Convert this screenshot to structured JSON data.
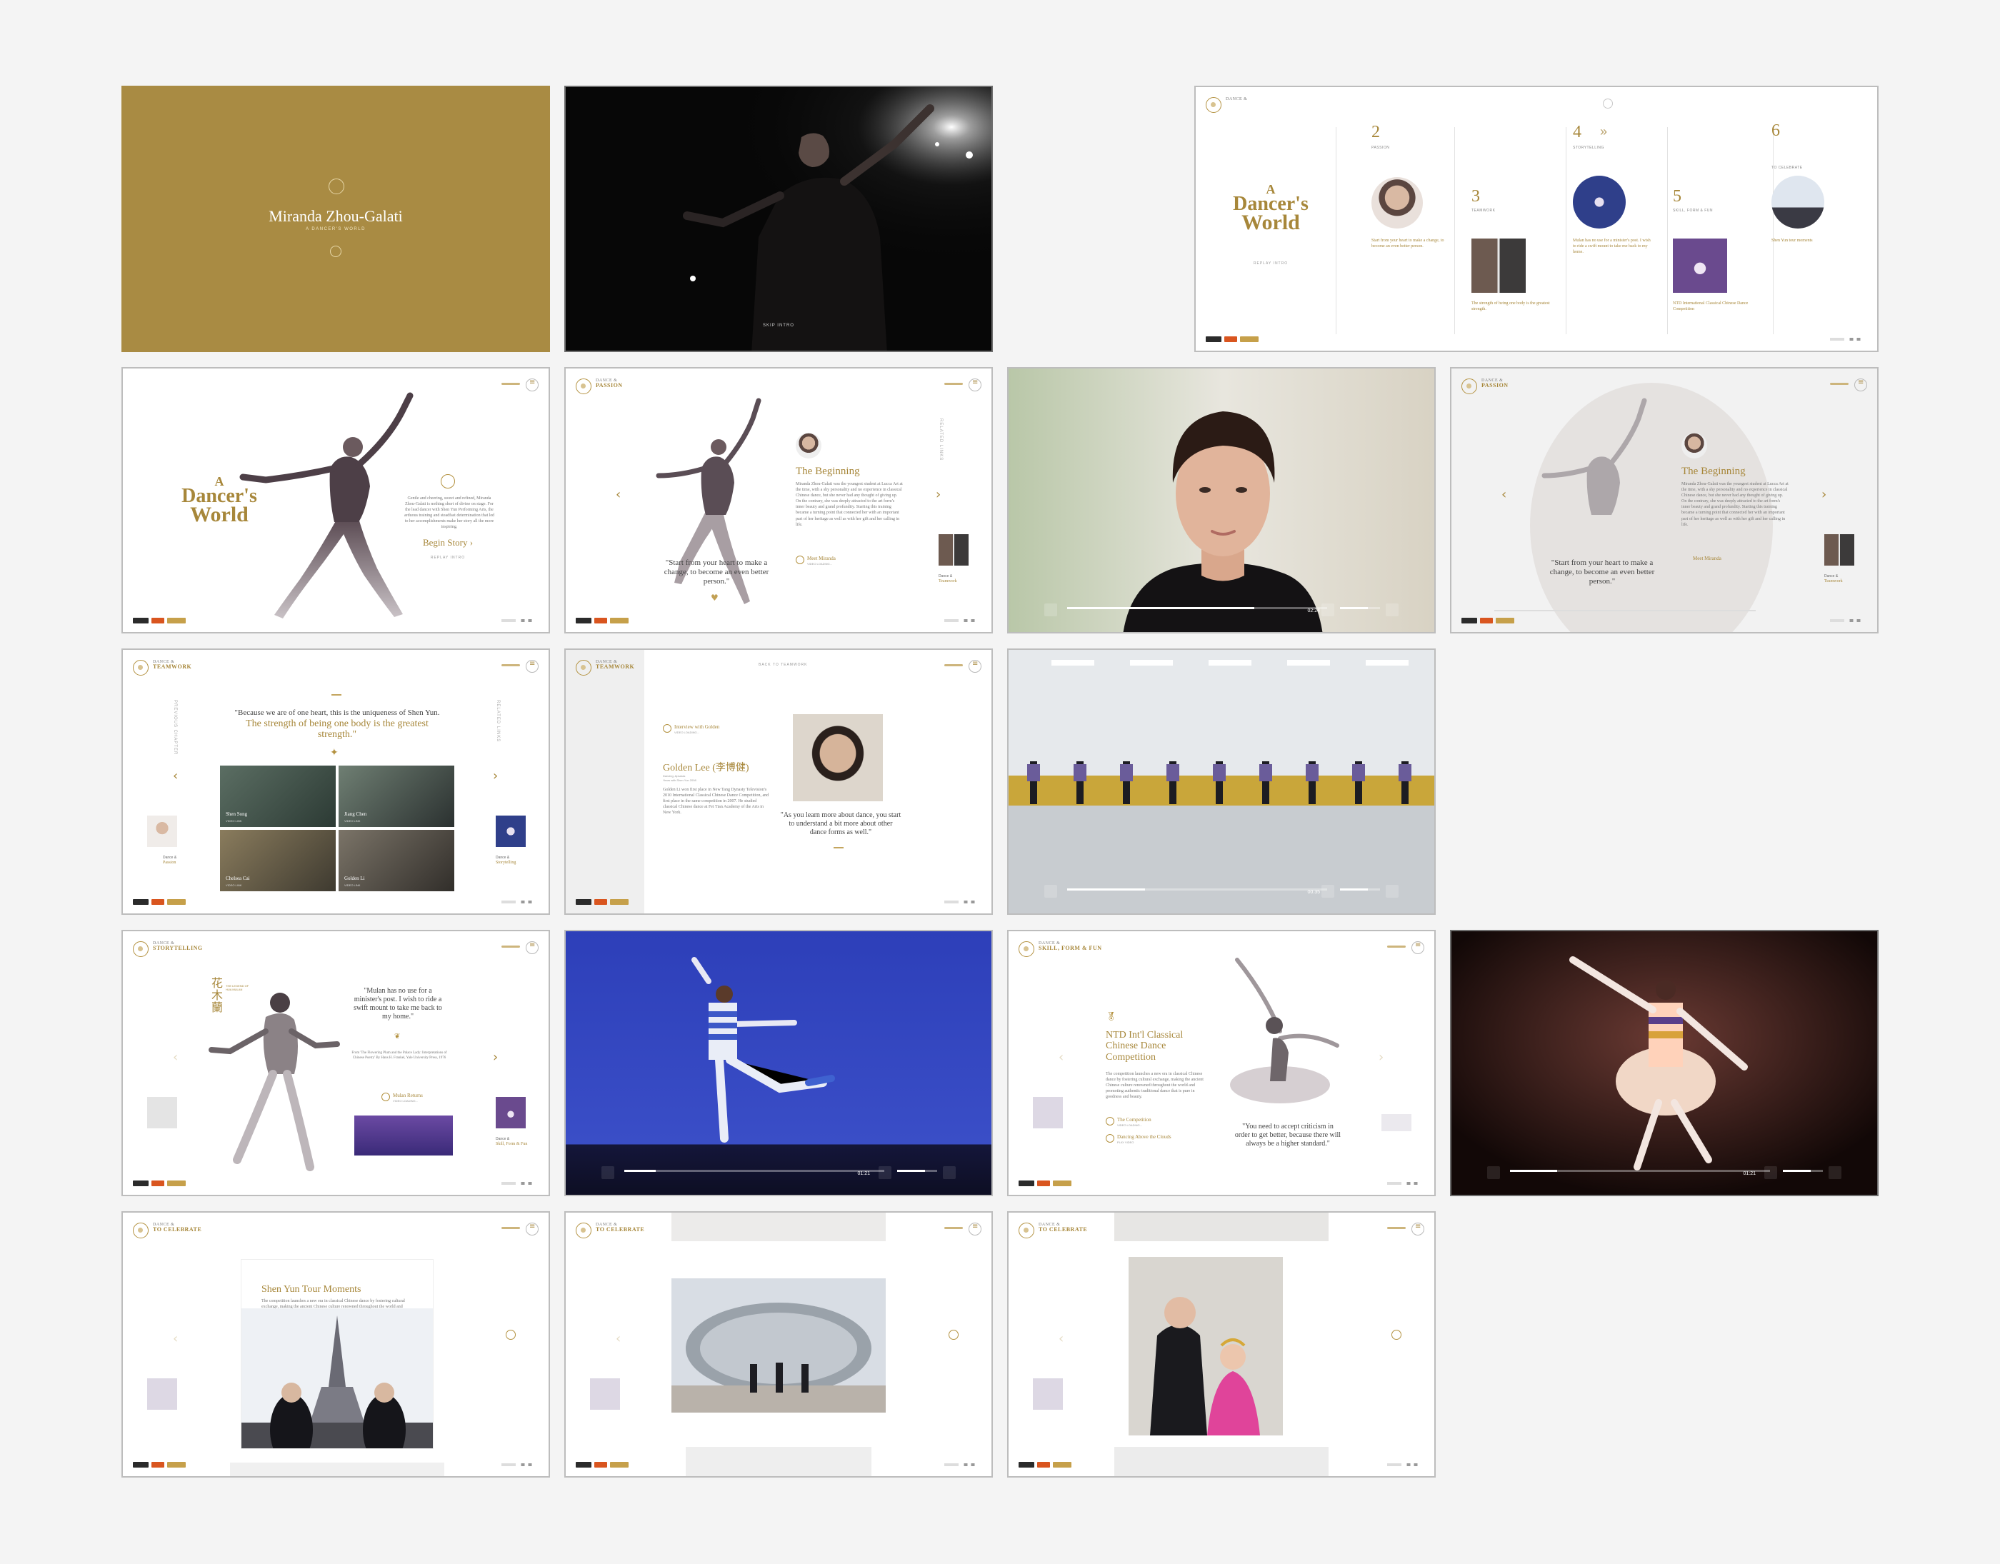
{
  "cover": {
    "name": "Miranda Zhou-Galati",
    "subtitle": "A DANCER'S WORLD"
  },
  "intro_video": {
    "skip": "SKIP INTRO"
  },
  "timeline": {
    "chapter_small": "DANCE &",
    "logo_line1": "A",
    "logo_line2": "Dancer's",
    "logo_line3": "World",
    "replay": "REPLAY INTRO",
    "items": [
      {
        "num": "2",
        "label": "PASSION",
        "caption": "Start from your heart to make a change, to become an even better person."
      },
      {
        "num": "3",
        "label": "TEAMWORK",
        "caption": "The strength of being one body is the greatest strength."
      },
      {
        "num": "4",
        "label": "STORYTELLING",
        "caption": "Mulan has no use for a minister's post. I wish to ride a swift mount to take me back to my home."
      },
      {
        "num": "5",
        "label": "SKILL, FORM & FUN",
        "caption": "NTD International Classical Chinese Dance Competition"
      },
      {
        "num": "6",
        "label": "TO CELEBRATE",
        "caption": "Shen Yun tour moments"
      }
    ]
  },
  "landing": {
    "logo_line1": "A",
    "logo_line2": "Dancer's",
    "logo_line3": "World",
    "body": "Gentle and cheering, sweet and refined, Miranda Zhou-Galati is nothing short of divine on stage. For the lead dancer with Shen Yun Performing Arts, the arduous training and steadfast determination that led to her accomplishments make her story all the more inspiring.",
    "cta": "Begin Story ›",
    "replay": "REPLAY INTRO"
  },
  "passion": {
    "chap_small": "DANCE &",
    "chap_big": "PASSION",
    "title": "The Beginning",
    "body": "Miranda Zhou-Galati was the youngest student at Lucca Art at the time, with a shy personality and no experience in classical Chinese dance, but she never had any thought of giving up. On the contrary, she was deeply attracted to the art form's inner beauty and grand profundity. Starting this training became a turning point that connected her with an important part of her heritage as well as with her gift and her calling in life.",
    "quote": "\"Start from your heart to make a change, to become an even better person.\"",
    "meet": "Meet Miranda",
    "meet_sub": "VIDEO LOADING...",
    "next_label": "Dance &",
    "next_name": "Teamwork",
    "vtext": "RELATED LINKS"
  },
  "interview_video": {
    "time": "02:24"
  },
  "teamwork": {
    "chap_small": "DANCE &",
    "chap_big": "TEAMWORK",
    "quote_a": "\"Because we are of one heart, this is the uniqueness of Shen Yun.",
    "quote_b": "The strength of being one body is the greatest strength.\"",
    "people": [
      {
        "name": "Shen Song",
        "role": "VIDEO LINK"
      },
      {
        "name": "Jiang Chen",
        "role": "VIDEO LINK"
      },
      {
        "name": "Chelsea Cai",
        "role": "VIDEO LINK"
      },
      {
        "name": "Golden Li",
        "role": "VIDEO LINK"
      }
    ],
    "prev_label": "Dance &",
    "prev_name": "Passion",
    "next_label": "Dance &",
    "next_name": "Storytelling",
    "vtext_l": "PREVIOUS CHAPTER",
    "vtext_r": "RELATED LINKS"
  },
  "golden": {
    "back": "BACK TO TEAMWORK",
    "interview": "Interview with Golden",
    "interview_sub": "VIDEO LOADING...",
    "name": "Golden Lee (李博健)",
    "meta1": "Dancing, Apsaras",
    "meta2": "Years with Shen Yun 2008",
    "body": "Golden Li won first place in New Tang Dynasty Television's 2010 International Classical Chinese Dance Competition, and first place in the same competition in 2007. He studied classical Chinese dance at Fei Tian Academy of the Arts in New York.",
    "quote": "\"As you learn more about dance, you start to understand a bit more about other dance forms as well.\""
  },
  "barre_video": {
    "time": "00:35"
  },
  "storytelling": {
    "chap_small": "DANCE &",
    "chap_big": "STORYTELLING",
    "chars": [
      "花",
      "木",
      "蘭"
    ],
    "mini": "THE LEGEND OF HUA MULAN",
    "quote": "\"Mulan has no use for a minister's post. I wish to ride a swift mount to take me back to my home.\"",
    "source": "From 'The Flowering Plum and the Palace Lady: Interpretations of Chinese Poetry' By Hans H. Frankel, Yale University Press, 1976",
    "mulan": "Mulan Returns",
    "mulan_sub": "VIDEO LOADING...",
    "next_label": "Dance &",
    "next_name": "Skill, Form & Fun"
  },
  "mulan_video": {
    "time": "01:21"
  },
  "skill": {
    "chap_small": "DANCE &",
    "chap_big": "SKILL, FORM & FUN",
    "title": "NTD Int'l Classical Chinese Dance Competition",
    "body": "The competition launches a new era in classical Chinese dance by fostering cultural exchange, making the ancient Chinese culture renowned throughout the world and promoting authentic traditional dance that is pure in goodness and beauty.",
    "link1": "The Competition",
    "link1_sub": "VIDEO LOADING...",
    "link2": "Dancing Above the Clouds",
    "link2_sub": "PLAY VIDEO",
    "quote": "\"You need to accept criticism in order to get better, because there will always be a higher standard.\""
  },
  "solo_video": {
    "time": "01:21"
  },
  "celebrate": {
    "chap_small": "DANCE &",
    "chap_big": "TO CELEBRATE",
    "title": "Shen Yun Tour Moments",
    "body": "The competition launches a new era in classical Chinese dance by fostering cultural exchange, making the ancient Chinese culture renowned throughout the world and promoting authentic traditional dance that is pure in goodness and beauty."
  },
  "colors": {
    "gold": "#a7873a",
    "cover_bg": "#a98b43",
    "page_bg": "#f4f4f4"
  }
}
